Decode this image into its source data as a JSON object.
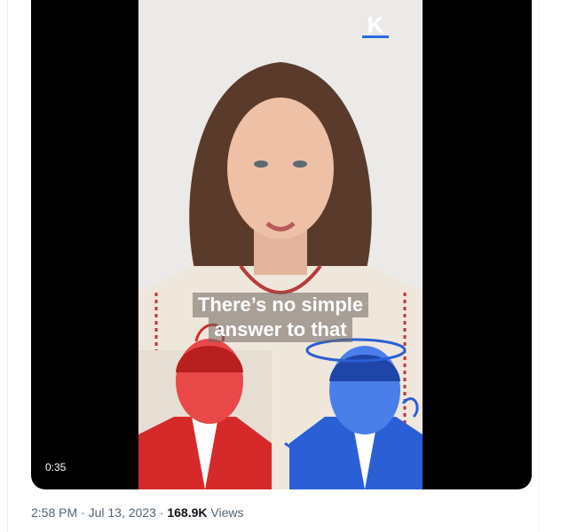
{
  "video": {
    "logo_letter": "K",
    "caption_line1": "There’s no simple",
    "caption_line2": "answer to that",
    "duration": "0:35",
    "accent_red": "#d62a2a",
    "accent_blue": "#2a5fd6"
  },
  "tweet_meta": {
    "time": "2:58 PM",
    "separator1": "·",
    "date": "Jul 13, 2023",
    "separator2": "·",
    "views_count": "168.9K",
    "views_label": "Views"
  }
}
